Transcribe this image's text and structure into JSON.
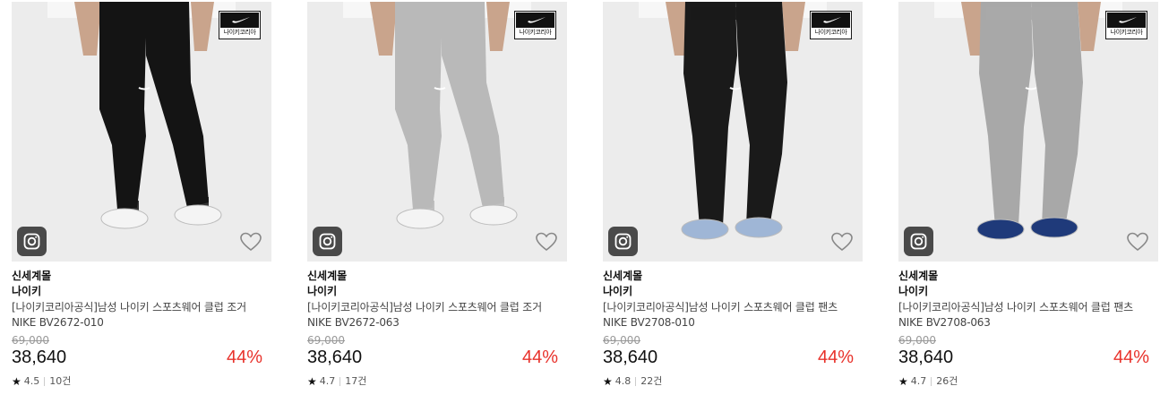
{
  "products": [
    {
      "mall": "신세계몰",
      "brand": "나이키",
      "title": "[나이키코리아공식]남성 나이키 스포츠웨어 클럽 조거 NIKE BV2672-010",
      "original_price": "69,000",
      "price": "38,640",
      "discount": "44%",
      "rating": "4.5",
      "review_count": "10건",
      "badge_text": "나이키코리아",
      "pants_color": "#141414",
      "shoe_color": "#f4f4f4",
      "style": "jogger"
    },
    {
      "mall": "신세계몰",
      "brand": "나이키",
      "title": "[나이키코리아공식]남성 나이키 스포츠웨어 클럽 조거 NIKE BV2672-063",
      "original_price": "69,000",
      "price": "38,640",
      "discount": "44%",
      "rating": "4.7",
      "review_count": "17건",
      "badge_text": "나이키코리아",
      "pants_color": "#b9b9b9",
      "shoe_color": "#f4f4f4",
      "style": "jogger"
    },
    {
      "mall": "신세계몰",
      "brand": "나이키",
      "title": "[나이키코리아공식]남성 나이키 스포츠웨어 클럽 팬츠 NIKE BV2708-010",
      "original_price": "69,000",
      "price": "38,640",
      "discount": "44%",
      "rating": "4.8",
      "review_count": "22건",
      "badge_text": "나이키코리아",
      "pants_color": "#1a1a1a",
      "shoe_color": "#9fb6d6",
      "style": "straight"
    },
    {
      "mall": "신세계몰",
      "brand": "나이키",
      "title": "[나이키코리아공식]남성 나이키 스포츠웨어 클럽 팬츠 NIKE BV2708-063",
      "original_price": "69,000",
      "price": "38,640",
      "discount": "44%",
      "rating": "4.7",
      "review_count": "26건",
      "badge_text": "나이키코리아",
      "pants_color": "#a8a8a8",
      "shoe_color": "#1f3a7a",
      "style": "straight"
    }
  ],
  "colors": {
    "discount": "#e8322b",
    "thumb_bg": "#ececec",
    "text_dark": "#111111"
  },
  "icons": {
    "star": "star-icon",
    "heart": "heart-outline-icon",
    "instagram": "instagram-icon",
    "brand": "nike-swoosh-icon"
  }
}
